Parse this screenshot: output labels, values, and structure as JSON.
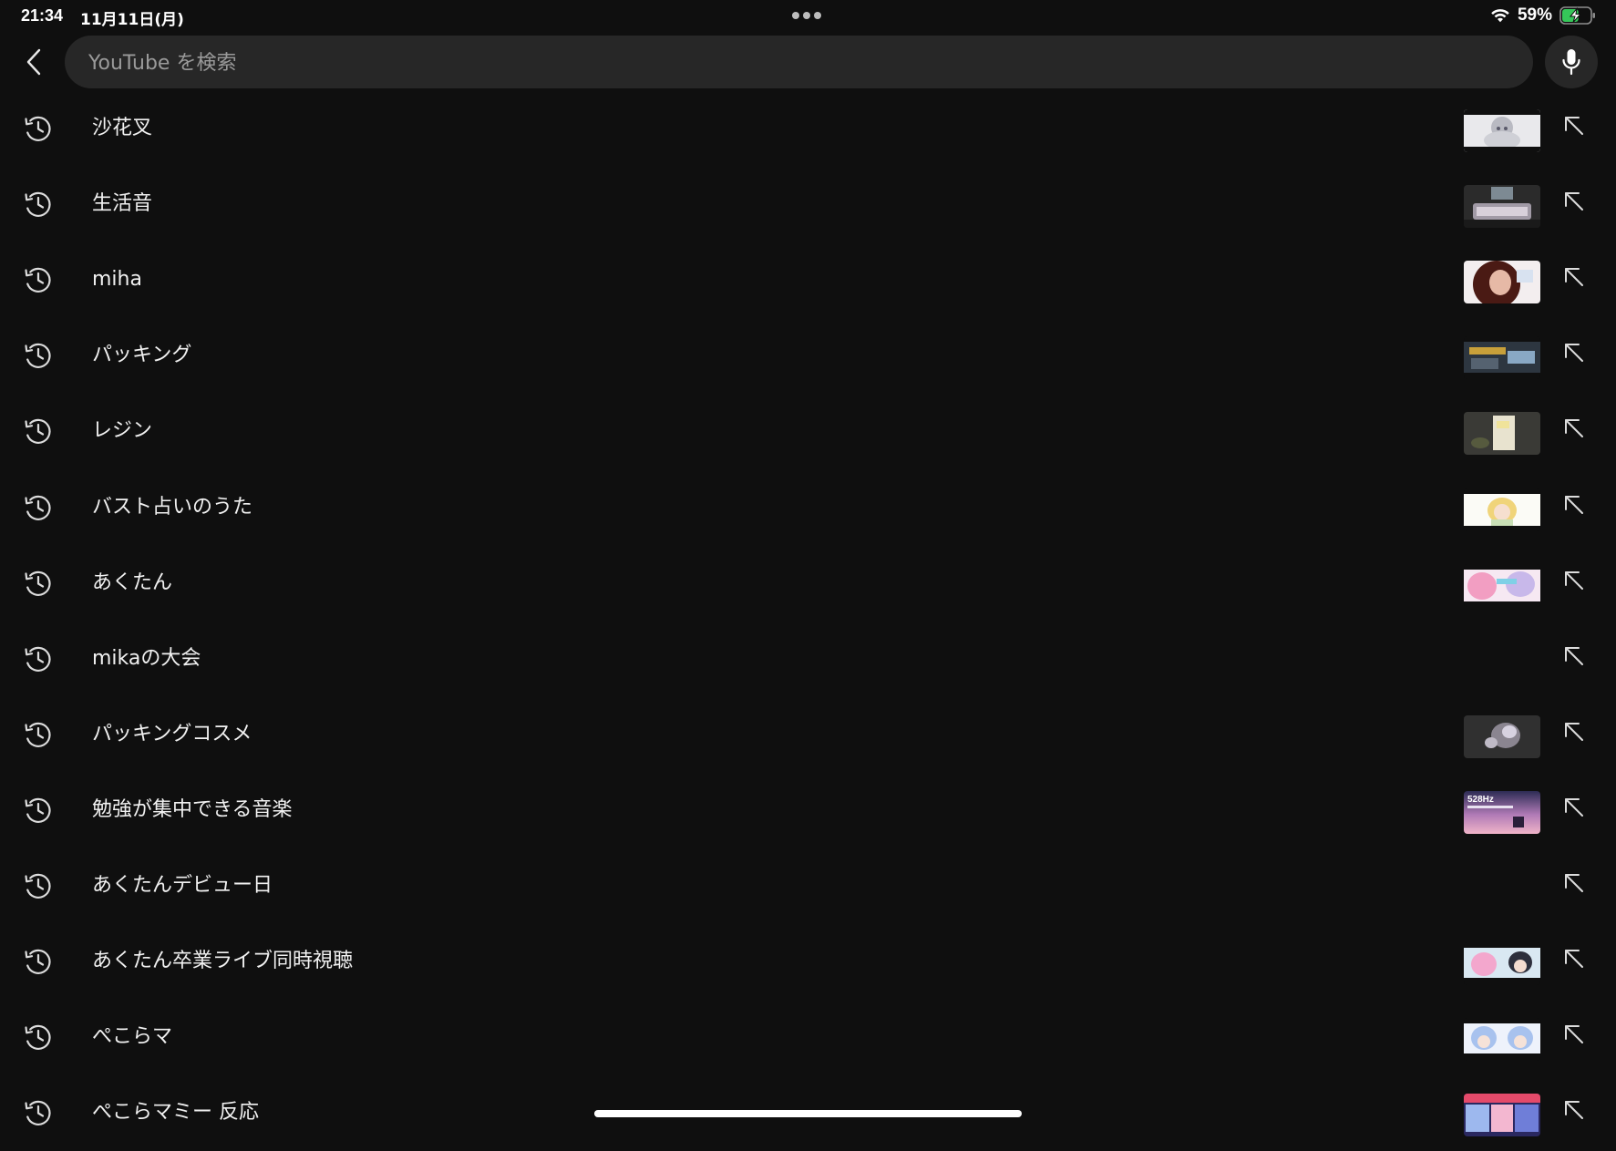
{
  "status_bar": {
    "time": "21:34",
    "date": "11月11日(月)",
    "battery_percent": "59%",
    "battery_level": 0.59,
    "battery_charging": true,
    "wifi_icon": "wifi-icon",
    "battery_icon": "battery-charging-icon",
    "multitask_icon": "more-dots-icon"
  },
  "header": {
    "back_icon": "chevron-left-icon",
    "search_placeholder": "YouTube を検索",
    "search_value": "",
    "mic_icon": "microphone-icon"
  },
  "suggestions": [
    {
      "query": "沙花叉",
      "thumbnail": "anime-girl-silver-hair"
    },
    {
      "query": "生活音",
      "thumbnail": "desk-keyboard"
    },
    {
      "query": "miha",
      "thumbnail": "woman-portrait"
    },
    {
      "query": "パッキング",
      "thumbnail": "packing-desk"
    },
    {
      "query": "レジン",
      "thumbnail": "resin-craft"
    },
    {
      "query": "バスト占いのうた",
      "thumbnail": "anime-blonde-girl"
    },
    {
      "query": "あくたん",
      "thumbnail": "anime-pink-hair"
    },
    {
      "query": "mikaの大会",
      "thumbnail": null
    },
    {
      "query": "パッキングコスメ",
      "thumbnail": "cosmetics-hands"
    },
    {
      "query": "勉強が集中できる音楽",
      "thumbnail": "528hz-purple-sunset"
    },
    {
      "query": "あくたんデビュー日",
      "thumbnail": null
    },
    {
      "query": "あくたん卒業ライブ同時視聴",
      "thumbnail": "anime-pink-and-dark"
    },
    {
      "query": "ぺこらマ",
      "thumbnail": "anime-blue-twins"
    },
    {
      "query": "ぺこらマミー 反応",
      "thumbnail": "anime-collage"
    }
  ],
  "row_icons": {
    "history": "history-clock-icon",
    "fill": "arrow-up-left-icon"
  },
  "colors": {
    "background": "#0f0f0f",
    "search_field": "#272727",
    "text": "#f1f1f1",
    "placeholder": "#9a9a9a",
    "battery_green": "#35c759"
  }
}
